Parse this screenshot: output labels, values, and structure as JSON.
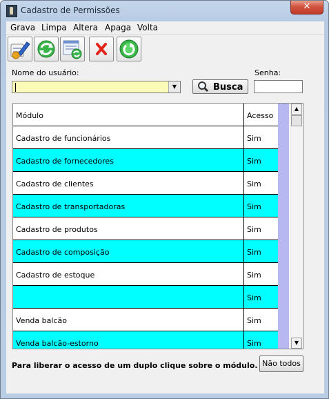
{
  "window": {
    "title": "Cadastro de Permissões",
    "close_glyph": "✕"
  },
  "menu": [
    "Grava",
    "Limpa",
    "Altera",
    "Apaga",
    "Volta"
  ],
  "toolbar": {
    "icons": [
      "edit-icon",
      "refresh-icon",
      "update-list-icon",
      "delete-icon",
      "exit-icon"
    ]
  },
  "form": {
    "user_label": "Nome do usuário:",
    "user_value": "",
    "search_label": "Busca",
    "password_label": "Senha:",
    "password_value": ""
  },
  "grid": {
    "columns": [
      "Módulo",
      "Acesso"
    ],
    "rows": [
      {
        "modulo": "Cadastro de funcionários",
        "acesso": "Sim",
        "highlight": false
      },
      {
        "modulo": "Cadastro de fornecedores",
        "acesso": "Sim",
        "highlight": true
      },
      {
        "modulo": "Cadastro de clientes",
        "acesso": "Sim",
        "highlight": false
      },
      {
        "modulo": "Cadastro de transportadoras",
        "acesso": "Sim",
        "highlight": true
      },
      {
        "modulo": "Cadastro de produtos",
        "acesso": "Sim",
        "highlight": false
      },
      {
        "modulo": "Cadastro de composição",
        "acesso": "Sim",
        "highlight": true
      },
      {
        "modulo": "Cadastro de estoque",
        "acesso": "Sim",
        "highlight": false
      },
      {
        "modulo": "",
        "acesso": "Sim",
        "highlight": true
      },
      {
        "modulo": "Venda balcão",
        "acesso": "Sim",
        "highlight": false
      },
      {
        "modulo": "Venda balcão-estorno",
        "acesso": "Sim",
        "highlight": true
      }
    ]
  },
  "footer": {
    "hint": "Para liberar o acesso de um duplo clique sobre o módulo.",
    "button_label": "Não todos"
  },
  "colors": {
    "highlight_row": "#00ffff",
    "combo_bg": "#fbfbb8",
    "side_strip": "#b7b7f2"
  }
}
